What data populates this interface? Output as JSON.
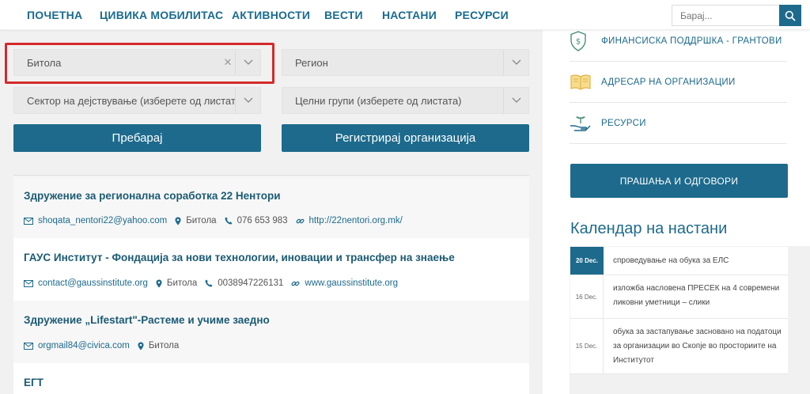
{
  "nav": {
    "items": [
      "ПОЧЕТНА",
      "ЦИВИКА МОБИЛИТАС",
      "АКТИВНОСТИ",
      "ВЕСТИ",
      "НАСТАНИ",
      "РЕСУРСИ"
    ],
    "search_placeholder": "Барај..."
  },
  "filters": {
    "city": "Битола",
    "region": "Регион",
    "sector": "Сектор на дејствување (изберете од листата)",
    "target": "Целни групи (изберете од листата)",
    "search_button": "Пребарај",
    "register_button": "Регистрирај организација"
  },
  "results": [
    {
      "title": "Здружение за регионална соработка 22 Нентори",
      "email": "shoqata_nentori22@yahoo.com",
      "city": "Битола",
      "phone": "076 653 983",
      "web": "http://22nentori.org.mk/"
    },
    {
      "title": "ГАУС Институт - Фондација за нови технологии, иновации и трансфер на знаење",
      "email": "contact@gaussinstitute.org",
      "city": "Битола",
      "phone": "0038947226131",
      "web": "www.gaussinstitute.org"
    },
    {
      "title": "Здружение „Lifestart\"-Растеме и учиме заедно",
      "email": "orgmail84@civica.com",
      "city": "Битола"
    },
    {
      "title": "ЕГТ"
    }
  ],
  "sidebar": {
    "links": [
      {
        "label": "ФИНАНСИСКА ПОДДРШКА - ГРАНТОВИ",
        "icon": "money-shield-icon"
      },
      {
        "label": "АДРЕСАР НА ОРГАНИЗАЦИИ",
        "icon": "book-icon"
      },
      {
        "label": "РЕСУРСИ",
        "icon": "hand-plant-icon"
      }
    ],
    "faq_button": "ПРАШАЊА И ОДГОВОРИ",
    "calendar_title": "Календар на настани",
    "events": [
      {
        "date": "20 Dec.",
        "text": "спроведување на обука за ЕЛС"
      },
      {
        "date": "16 Dec.",
        "text": "изложба насловена ПРЕСЕК на 4 современи ликовни уметници – слики"
      },
      {
        "date": "15 Dec.",
        "text": "обука за застапување засновано на податоци за организации во Скопје во просториите на Институтот"
      }
    ]
  },
  "colors": {
    "primary": "#1d6a8c",
    "title": "#1b5b73",
    "highlight": "#d42a2a",
    "icon_green": "#4a8f7a",
    "icon_gold": "#e0b44a"
  }
}
